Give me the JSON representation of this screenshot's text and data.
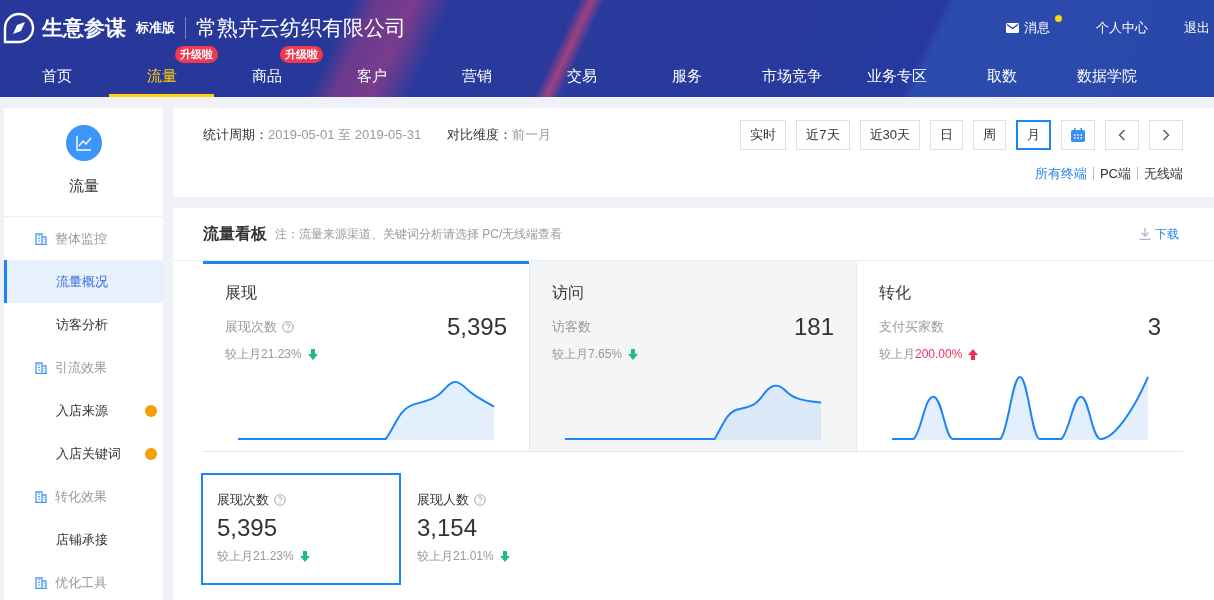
{
  "header": {
    "product": "生意参谋",
    "edition": "标准版",
    "shop": "常熟卉云纺织有限公司",
    "messages": {
      "label": "消息",
      "unread": true
    },
    "links": [
      "个人中心",
      "退出"
    ]
  },
  "nav": [
    {
      "label": "首页",
      "selected": false
    },
    {
      "label": "流量",
      "selected": true,
      "badge": "升级啦"
    },
    {
      "label": "商品",
      "selected": false,
      "badge": "升级啦"
    },
    {
      "label": "客户",
      "selected": false
    },
    {
      "label": "营销",
      "selected": false
    },
    {
      "label": "交易",
      "selected": false
    },
    {
      "label": "服务",
      "selected": false
    },
    {
      "label": "市场竞争",
      "selected": false
    },
    {
      "label": "业务专区",
      "selected": false
    },
    {
      "label": "取数",
      "selected": false
    },
    {
      "label": "数据学院",
      "selected": false
    }
  ],
  "sidebar": {
    "title": "流量",
    "groups": [
      {
        "label": "整体监控",
        "items": [
          {
            "label": "流量概况",
            "selected": true,
            "dot": false
          },
          {
            "label": "访客分析",
            "selected": false,
            "dot": false
          }
        ]
      },
      {
        "label": "引流效果",
        "items": [
          {
            "label": "入店来源",
            "selected": false,
            "dot": true
          },
          {
            "label": "入店关键词",
            "selected": false,
            "dot": true
          }
        ]
      },
      {
        "label": "转化效果",
        "items": [
          {
            "label": "店铺承接",
            "selected": false,
            "dot": false
          }
        ]
      },
      {
        "label": "优化工具"
      }
    ]
  },
  "filter": {
    "period_label": "统计周期：",
    "period": "2019-05-01 至 2019-05-31",
    "compare_label": "对比维度：",
    "compare": "前一月",
    "ranges": [
      {
        "label": "实时",
        "selected": false
      },
      {
        "label": "近7天",
        "selected": false
      },
      {
        "label": "近30天",
        "selected": false
      },
      {
        "label": "日",
        "selected": false
      },
      {
        "label": "周",
        "selected": false
      },
      {
        "label": "月",
        "selected": true
      }
    ],
    "terminals": [
      {
        "label": "所有终端",
        "selected": true
      },
      {
        "label": "PC端",
        "selected": false
      },
      {
        "label": "无线端",
        "selected": false
      }
    ]
  },
  "board": {
    "title": "流量看板",
    "note": "注：流量来源渠道、关键词分析请选择 PC/无线端查看",
    "download": "下载",
    "cards": [
      {
        "title": "展现",
        "metric": "展现次数",
        "help": true,
        "value": "5,395",
        "change_label": "较上月",
        "change": "21.23%",
        "increase": false,
        "selected": true,
        "hovered": false
      },
      {
        "title": "访问",
        "metric": "访客数",
        "help": false,
        "value": "181",
        "change_label": "较上月",
        "change": "7.65%",
        "increase": false,
        "selected": false,
        "hovered": true
      },
      {
        "title": "转化",
        "metric": "支付买家数",
        "help": false,
        "value": "3",
        "change_label": "较上月",
        "change": "200.00%",
        "increase": true,
        "selected": false,
        "hovered": false
      }
    ],
    "tiles": [
      {
        "label": "展现次数",
        "value": "5,395",
        "change_label": "较上月",
        "change": "21.23%",
        "increase": false,
        "selected": true
      },
      {
        "label": "展现人数",
        "value": "3,154",
        "change_label": "较上月",
        "change": "21.01%",
        "increase": false,
        "selected": false
      }
    ]
  }
}
